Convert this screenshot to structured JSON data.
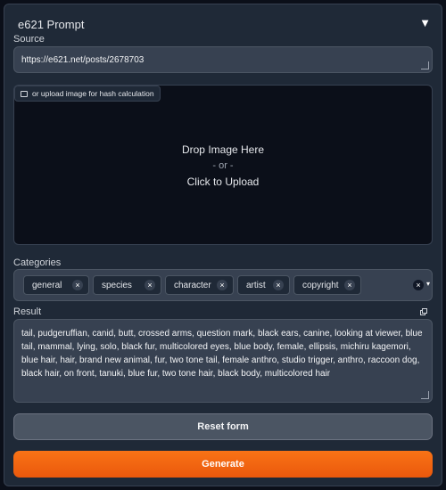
{
  "panel": {
    "title": "e621 Prompt",
    "collapse_icon": "▼"
  },
  "source": {
    "label": "Source",
    "value": "https://e621.net/posts/2678703"
  },
  "upload": {
    "label": "or upload image for hash calculation",
    "drop_text": "Drop Image Here",
    "or_text": "- or -",
    "click_text": "Click to Upload"
  },
  "categories": {
    "label": "Categories",
    "chips": [
      "general",
      "species",
      "character",
      "artist",
      "copyright"
    ]
  },
  "result": {
    "label": "Result",
    "value": "tail, pudgeruffian, canid, butt, crossed arms, question mark, black ears, canine, looking at viewer, blue tail, mammal, lying, solo, black fur, multicolored eyes, blue body, female, ellipsis, michiru kagemori, blue hair, hair, brand new animal, fur, two tone tail, female anthro, studio trigger, anthro, raccoon dog, black hair, on front, tanuki, blue fur, two tone hair, black body, multicolored hair"
  },
  "buttons": {
    "reset": "Reset form",
    "generate": "Generate"
  },
  "icons": {
    "image": "image-icon",
    "copy": "copy-icon",
    "remove": "×"
  },
  "colors": {
    "accent": "#f97316",
    "background": "#0b0f19",
    "panel": "#1f2937"
  }
}
